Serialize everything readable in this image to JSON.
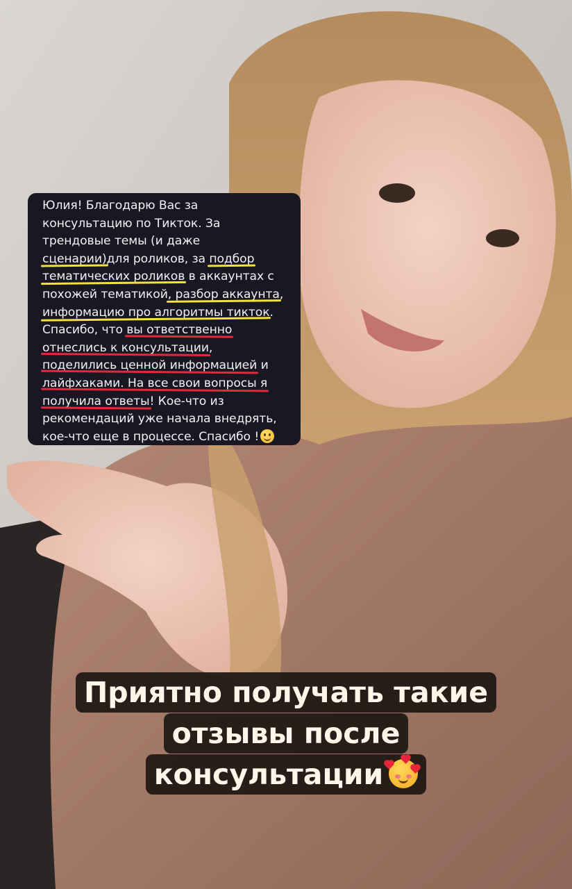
{
  "review": {
    "lines": [
      [
        {
          "t": "Юлия! Благодарю Вас за"
        }
      ],
      [
        {
          "t": "консультацию по Тикток. За"
        }
      ],
      [
        {
          "t": "трендовые темы (и даже"
        }
      ],
      [
        {
          "t": "сценарии)",
          "u": "y"
        },
        {
          "t": "для роликов, за "
        },
        {
          "t": "подбор",
          "u": "y"
        }
      ],
      [
        {
          "t": "тематических роликов",
          "u": "y"
        },
        {
          "t": " в аккаунтах с"
        }
      ],
      [
        {
          "t": "похожей тематикой"
        },
        {
          "t": ", разбор аккаунта",
          "u": "y"
        },
        {
          "t": ","
        }
      ],
      [
        {
          "t": "информацию про алгоритмы тикток",
          "u": "y"
        },
        {
          "t": "."
        }
      ],
      [
        {
          "t": "Спасибо, что "
        },
        {
          "t": "вы ответственно",
          "u": "r"
        }
      ],
      [
        {
          "t": "отнеслись к консультации",
          "u": "r"
        },
        {
          "t": ","
        }
      ],
      [
        {
          "t": "поделились ценной информацией",
          "u": "r"
        },
        {
          "t": " и"
        }
      ],
      [
        {
          "t": "лайфхаками. На все свои вопросы я",
          "u": "r"
        }
      ],
      [
        {
          "t": "получила ответы",
          "u": "r"
        },
        {
          "t": "! Кое-что из"
        }
      ],
      [
        {
          "t": "рекомендаций уже начала внедрять,"
        }
      ],
      [
        {
          "t": "кое-что еще в процессе. Спасибо !"
        },
        {
          "icon": "slightly-smiling-face-emoji"
        }
      ]
    ]
  },
  "caption": {
    "line1": "Приятно получать такие",
    "line2": "отзывы после",
    "line3": "консультации",
    "emoji": "smiling-face-with-hearts-emoji"
  },
  "colors": {
    "card_bg": "#191722",
    "underline_yellow": "#f3e23a",
    "underline_red": "#e5283c",
    "caption_bg": "#1e1814",
    "caption_text": "#fff6ea"
  }
}
